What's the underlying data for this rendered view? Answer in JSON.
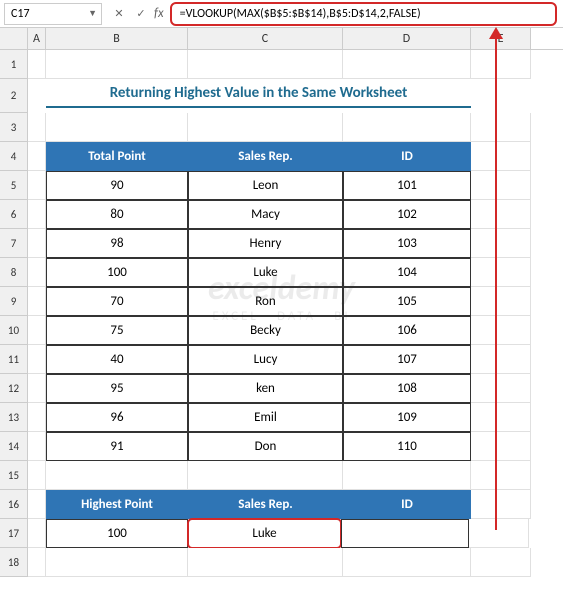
{
  "namebox": {
    "ref": "C17"
  },
  "formula": {
    "text": "=VLOOKUP(MAX($B$5:$B$14),B$5:D$14,2,FALSE)"
  },
  "title": "Returning Highest Value in the Same Worksheet",
  "cols": [
    "A",
    "B",
    "C",
    "D",
    "E"
  ],
  "rownums": [
    "1",
    "2",
    "3",
    "4",
    "5",
    "6",
    "7",
    "8",
    "9",
    "10",
    "11",
    "12",
    "13",
    "14",
    "15",
    "16",
    "17",
    "18"
  ],
  "table": {
    "headers": {
      "b": "Total Point",
      "c": "Sales Rep.",
      "d": "ID"
    },
    "rows": [
      {
        "b": "90",
        "c": "Leon",
        "d": "101"
      },
      {
        "b": "80",
        "c": "Macy",
        "d": "102"
      },
      {
        "b": "98",
        "c": "Henry",
        "d": "103"
      },
      {
        "b": "100",
        "c": "Luke",
        "d": "104"
      },
      {
        "b": "70",
        "c": "Ron",
        "d": "105"
      },
      {
        "b": "75",
        "c": "Becky",
        "d": "106"
      },
      {
        "b": "40",
        "c": "Lucy",
        "d": "107"
      },
      {
        "b": "95",
        "c": "ken",
        "d": "108"
      },
      {
        "b": "96",
        "c": "Emil",
        "d": "109"
      },
      {
        "b": "91",
        "c": "Don",
        "d": "110"
      }
    ]
  },
  "result": {
    "headers": {
      "b": "Highest Point",
      "c": "Sales Rep.",
      "d": "ID"
    },
    "row": {
      "b": "100",
      "c": "Luke",
      "d": ""
    }
  },
  "watermark": {
    "l1": "exceldemy",
    "l2": "EXCEL · DATA · BI"
  }
}
